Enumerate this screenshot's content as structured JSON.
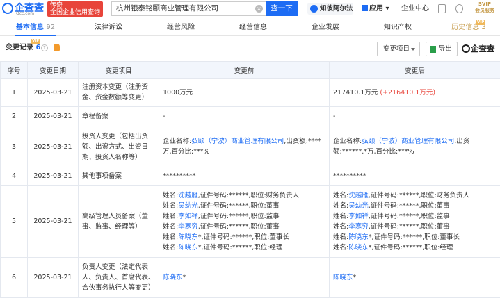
{
  "header": {
    "logo_text": "企查查",
    "logo_sub": "Qcc.com",
    "slogan_line1": "传奇",
    "slogan_line2": "全国企业信用查询",
    "search_value": "杭州银泰铭颐商业管理有限公司",
    "search_button": "查一下",
    "zhibi": "知彼阿尔法",
    "app": "应用",
    "user_center": "企业中心",
    "vip_line1": "SVIP",
    "vip_line2": "会员服务"
  },
  "tabs": [
    {
      "label": "基本信息",
      "count": "92"
    },
    {
      "label": "法律诉讼",
      "count": ""
    },
    {
      "label": "经营风险",
      "count": ""
    },
    {
      "label": "经营信息",
      "count": ""
    },
    {
      "label": "企业发展",
      "count": ""
    },
    {
      "label": "知识产权",
      "count": ""
    },
    {
      "label": "历史信息",
      "count": "3"
    }
  ],
  "vip_tag": "VIP",
  "section": {
    "title": "变更记录",
    "count": "6",
    "help": "?",
    "filter_button": "变更项目",
    "export_button": "导出",
    "brand": "企查查"
  },
  "table": {
    "headers": [
      "序号",
      "变更日期",
      "变更项目",
      "变更前",
      "变更后"
    ],
    "rows": [
      {
        "no": "1",
        "date": "2025-03-21",
        "item": "注册资本变更（注册资金、资金数额等变更）",
        "before": "1000万元",
        "after": "217410.1万元",
        "after_extra": "(+216410.1万元)"
      },
      {
        "no": "2",
        "date": "2025-03-21",
        "item": "章程备案",
        "before": "-",
        "after": "-"
      },
      {
        "no": "3",
        "date": "2025-03-21",
        "item": "投资人变更（包括出资额、出资方式、出资日期、投资人名称等）",
        "before_prefix": "企业名称:",
        "before_link": "弘颐（宁波）商业管理有限公司",
        "before_suffix": ",出资额:****万,百分比:***%",
        "after_prefix": "企业名称:",
        "after_link": "弘颐（宁波）商业管理有限公司",
        "after_suffix": ",出资额:******.*万,百分比:***%"
      },
      {
        "no": "4",
        "date": "2025-03-21",
        "item": "其他事项备案",
        "before": "**********",
        "after": "**********"
      },
      {
        "no": "5",
        "date": "2025-03-21",
        "item": "高级管理人员备案（董事、监事、经理等）",
        "people": [
          {
            "name": "沈越雁",
            "rest": ",证件号码:******,职位:财务负责人"
          },
          {
            "name": "吴幼光",
            "rest": ",证件号码:******,职位:董事"
          },
          {
            "name": "李如祥",
            "rest": ",证件号码:******,职位:监事"
          },
          {
            "name": "李寒穷",
            "rest": ",证件号码:******,职位:董事"
          },
          {
            "name": "陈晓东",
            "rest": "*,证件号码:******,职位:董事长"
          },
          {
            "name": "陈晓东",
            "rest": "*,证件号码:******,职位:经理"
          }
        ],
        "people_after": [
          {
            "name": "沈越雁",
            "rest": ",证件号码:******,职位:财务负责人"
          },
          {
            "name": "吴幼光",
            "rest": ",证件号码:******,职位:董事"
          },
          {
            "name": "李如祥",
            "rest": ",证件号码:******,职位:监事"
          },
          {
            "name": "李寒穷",
            "rest": ",证件号码:******,职位:董事"
          },
          {
            "name": "陈晓东",
            "rest": "*,证件号码:******,职位:董事长"
          },
          {
            "name": "陈晓东",
            "rest": "*,证件号码:******,职位:经理"
          }
        ],
        "name_prefix": "姓名:"
      },
      {
        "no": "6",
        "date": "2025-03-21",
        "item": "负责人变更（法定代表人、负责人、首席代表、合伙事务执行人等变更）",
        "before_link": "陈晓东",
        "before_suffix": "*",
        "after_link": "陈晓东",
        "after_suffix": "*"
      }
    ]
  }
}
